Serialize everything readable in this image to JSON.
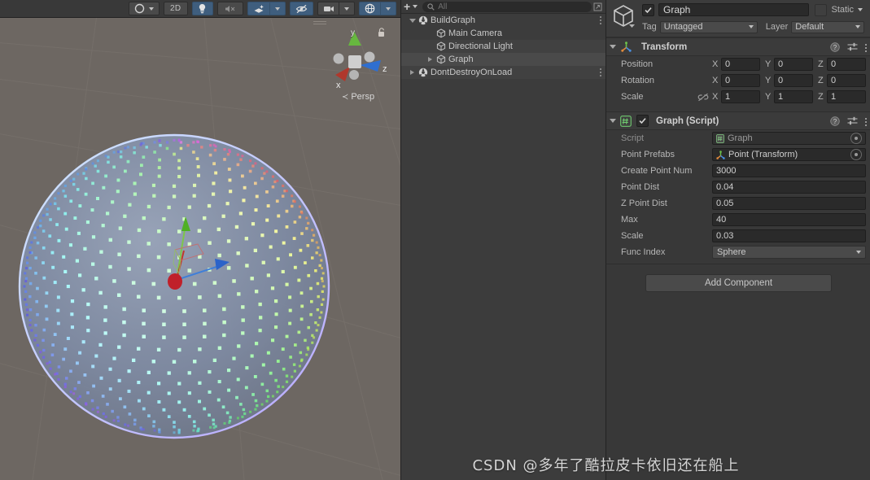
{
  "scene": {
    "toolbar": {
      "draw_mode": {
        "icon": "shaded-sphere-icon",
        "caret": "chevron-down-icon",
        "active": false
      },
      "toggle_2d": {
        "label": "2D",
        "active": false
      },
      "lighting": {
        "icon": "lightbulb-icon",
        "active": true
      },
      "audio": {
        "icon": "audio-mute-icon",
        "active": false
      },
      "effects": {
        "icon": "effects-icon",
        "active": true
      },
      "effects_caret": {
        "icon": "chevron-down-icon",
        "active": true
      },
      "hidden_objects": {
        "icon": "eye-off-icon",
        "active": true
      },
      "camera": {
        "icon": "camera-icon",
        "active": false
      },
      "camera_caret": {
        "icon": "chevron-down-icon",
        "active": false
      },
      "gizmos": {
        "icon": "gizmos-globe-icon",
        "active": true
      },
      "gizmos_caret": {
        "icon": "chevron-down-icon",
        "active": true
      }
    },
    "gizmo": {
      "x_label": "x",
      "y_label": "y",
      "z_label": "z",
      "projection": "Persp",
      "lock_icon": "padlock-open-icon",
      "x_color": "#c0392b",
      "y_color": "#5fb63a",
      "z_color": "#2f6fd0"
    },
    "background_color": "#6d6762",
    "content": {
      "description": "point-cloud sphere of small cubes",
      "point_count": 3000
    }
  },
  "hierarchy": {
    "toolbar": {
      "add_label": "+",
      "add_caret": "chevron-down-icon",
      "search_icon": "search-icon",
      "search_value": "",
      "search_placeholder": "All",
      "right_icon": "expand-icon"
    },
    "items": [
      {
        "label": "BuildGraph",
        "icon": "scene-icon",
        "indent": 0,
        "arrow": "open",
        "selected": false,
        "alt": false,
        "kebab": true
      },
      {
        "label": "Main Camera",
        "icon": "gameobject-icon",
        "indent": 1,
        "arrow": "none",
        "selected": false,
        "alt": false,
        "kebab": false
      },
      {
        "label": "Directional Light",
        "icon": "gameobject-icon",
        "indent": 1,
        "arrow": "none",
        "selected": false,
        "alt": true,
        "kebab": false
      },
      {
        "label": "Graph",
        "icon": "gameobject-icon",
        "indent": 1,
        "arrow": "closed",
        "selected": true,
        "alt": false,
        "kebab": false
      },
      {
        "label": "DontDestroyOnLoad",
        "icon": "scene-icon",
        "indent": 0,
        "arrow": "closed",
        "selected": false,
        "alt": true,
        "kebab": true
      }
    ]
  },
  "inspector": {
    "header": {
      "cube_icon": "gameobject-cube-icon",
      "enabled": true,
      "name": "Graph",
      "static_checked": false,
      "static_label": "Static",
      "static_caret": "chevron-down-icon",
      "tag_label": "Tag",
      "tag_value": "Untagged",
      "layer_label": "Layer",
      "layer_value": "Default"
    },
    "components": [
      {
        "title": "Transform",
        "icon": "transform-axes-icon",
        "has_enable_checkbox": false,
        "tools": [
          "help-icon",
          "preset-icon",
          "kebab-icon"
        ],
        "vector_rows": [
          {
            "label": "Position",
            "link_icon": "",
            "x": "0",
            "y": "0",
            "z": "0"
          },
          {
            "label": "Rotation",
            "link_icon": "",
            "x": "0",
            "y": "0",
            "z": "0"
          },
          {
            "label": "Scale",
            "link_icon": "link-broken-icon",
            "x": "1",
            "y": "1",
            "z": "1"
          }
        ],
        "axis_labels": [
          "X",
          "Y",
          "Z"
        ]
      },
      {
        "title": "Graph (Script)",
        "icon": "script-hash-icon",
        "has_enable_checkbox": true,
        "enabled": true,
        "tools": [
          "help-icon",
          "preset-icon",
          "kebab-icon"
        ],
        "fields": [
          {
            "label": "Script",
            "value": "Graph",
            "type": "object",
            "readonly": true,
            "icon": "script-asset-icon",
            "picker": true
          },
          {
            "label": "Point Prefabs",
            "value": "Point (Transform)",
            "type": "object",
            "readonly": false,
            "icon": "transform-axes-icon",
            "picker": true
          },
          {
            "label": "Create Point Num",
            "value": "3000",
            "type": "text"
          },
          {
            "label": "Point Dist",
            "value": "0.04",
            "type": "text"
          },
          {
            "label": "Z Point Dist",
            "value": "0.05",
            "type": "text"
          },
          {
            "label": "Max",
            "value": "40",
            "type": "text"
          },
          {
            "label": "Scale",
            "value": "0.03",
            "type": "text"
          },
          {
            "label": "Func Index",
            "value": "Sphere",
            "type": "dropdown"
          }
        ]
      }
    ],
    "add_component_label": "Add Component"
  },
  "watermark": {
    "text": "CSDN @多年了酷拉皮卡依旧还在船上"
  }
}
